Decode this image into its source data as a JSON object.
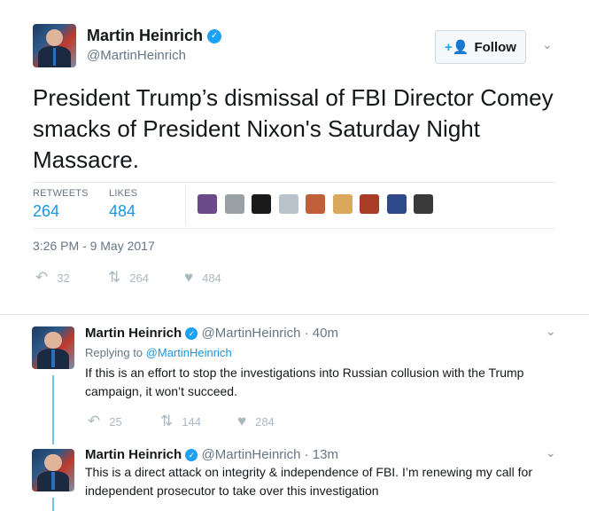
{
  "main_tweet": {
    "author_name": "Martin Heinrich",
    "author_handle": "@MartinHeinrich",
    "follow_label": "Follow",
    "text": "President Trump’s dismissal of FBI Director Comey smacks of President Nixon's Saturday Night Massacre.",
    "retweets_label": "RETWEETS",
    "retweets": "264",
    "likes_label": "LIKES",
    "likes": "484",
    "timestamp": "3:26 PM - 9 May 2017",
    "replies_count": "32",
    "retweet_count": "264",
    "like_count": "484",
    "likers": [
      "#6b4a8c",
      "#9aa1a6",
      "#1a1a1a",
      "#b9c3cc",
      "#c0603a",
      "#d9a85a",
      "#a83c26",
      "#2e4a8a",
      "#3a3a3a"
    ]
  },
  "replies": [
    {
      "author_name": "Martin Heinrich",
      "author_handle": "@MartinHeinrich",
      "time": "· 40m",
      "replying_prefix": "Replying to",
      "replying_handle": "@MartinHeinrich",
      "text": "If this is an effort to stop the investigations into Russian collusion with the Trump campaign, it won’t succeed.",
      "replies_count": "25",
      "retweet_count": "144",
      "like_count": "284"
    },
    {
      "author_name": "Martin Heinrich",
      "author_handle": "@MartinHeinrich",
      "time": "· 13m",
      "text": "This is a direct attack on integrity & independence of FBI. I’m renewing my call for independent prosecutor to take over this investigation"
    }
  ],
  "icons": {
    "verified": "verified-badge-icon",
    "follow": "add-user-icon",
    "chevron": "chevron-down-icon",
    "reply": "reply-icon",
    "retweet": "retweet-icon",
    "like": "heart-icon"
  },
  "colors": {
    "accent": "#1da1f2",
    "link": "#1b95e0",
    "muted": "#657786",
    "action": "#aab8c2"
  }
}
